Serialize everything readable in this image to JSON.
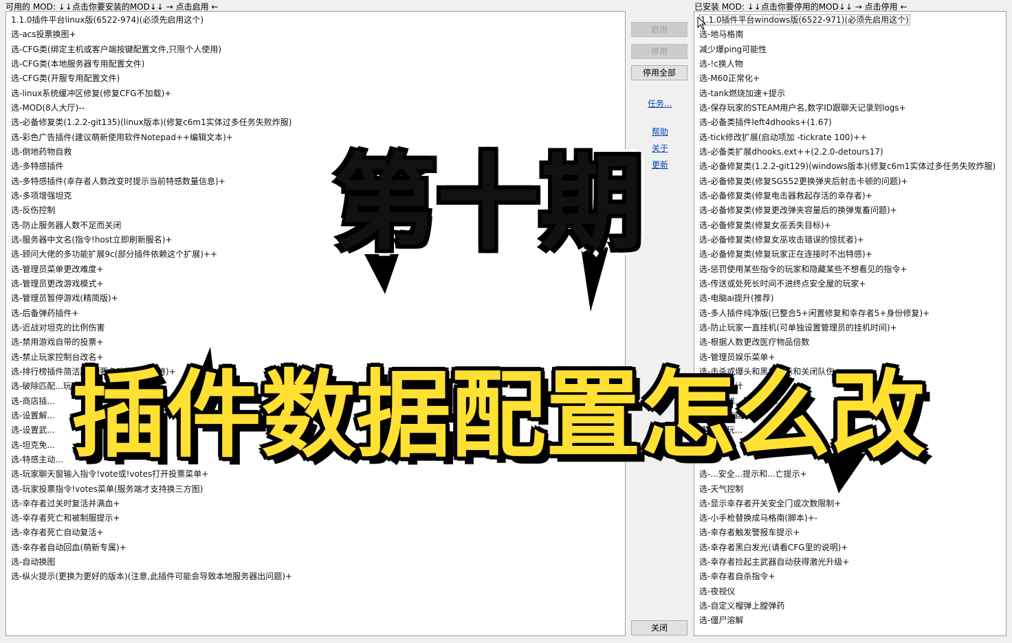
{
  "headers": {
    "available": "可用的 MOD: ↓↓点击你要安装的MOD↓↓ → 点击启用 ←",
    "installed": "已安装 MOD: ↓↓点击你要停用的MOD↓↓ → 点击停用 ←"
  },
  "available_mods": [
    "1.1.0插件平台linux版(6522-974)(必须先启用这个)",
    "选-acs投票换图+",
    "选-CFG类(绑定主机或客户端按键配置文件,只限个人使用)",
    "选-CFG类(本地服务器专用配置文件)",
    "选-CFG类(开服专用配置文件)",
    "选-linux系统缓冲区修复(修复CFG不加载)+",
    "选-MOD(8人大厅)--",
    "选-必备修复类(1.2.2-git135)(linux版本)(修复c6m1实体过多任务失败炸服)",
    "选-彩色广告插件(建议萌新使用软件Notepad++编辑文本)+",
    "选-倒地药物自救",
    "选-多特感插件",
    "选-多特感插件(幸存者人数改变时提示当前特感数量信息)+",
    "选-多项增强坦克",
    "选-反伤控制",
    "选-防止服务器人数不足而关闭",
    "选-服务器中文名(指令!host立即刷新服名)+",
    "选-顾问大佬的多功能扩展9c(部分插件依赖这个扩展)++",
    "选-管理员菜单更改难度+",
    "选-管理员更改游戏模式+",
    "选-管理员暂停游戏(精简版)+",
    "选-后备弹药插件+",
    "选-近战对坦克的比例伤害",
    "选-禁用游戏自带的投票+",
    "选-禁止玩家控制台改名+",
    "选-排行榜插件简洁版(需要多功能扩展支持)+",
    "选-破除匹配...玩家",
    "选-商店插...",
    "选-设置解...",
    "选-设置武...",
    "选-坦克免...",
    "选-特感主动...",
    "选-玩家聊天窗输入指令!vote或!votes打开投票菜单+",
    "选-玩家投票指令!votes菜单(服务端才支持换三方图)",
    "选-幸存者过关时复活并满血+",
    "选-幸存者死亡和被制服提示+",
    "选-幸存者死亡自动复活+",
    "选-幸存者自动回血(萌新专属)+",
    "选-自动换图",
    "选-纵火提示(更换为更好的版本)(注意,此插件可能会导致本地服务器出问题)+"
  ],
  "installed_mods": [
    "1.1.0插件平台windows版(6522-971)(必须先启用这个)",
    "选-地马格南",
    "减少爆ping可能性",
    "选-!c换人物",
    "选-M60正常化+",
    "选-tank燃烧加速+提示",
    "选-保存玩家的STEAM用户名,数字ID跟聊天记录到logs+",
    "选-必备类插件left4dhooks+(1.67)",
    "选-tick修改扩展(启动项加 -tickrate 100)++",
    "选-必备类扩展dhooks.ext++(2.2.0-detours17)",
    "选-必备修复类(1.2.2-git129)(windows版本)(修复c6m1实体过多任务失败炸服)",
    "选-必备修复类(修复SG552更换弹夹后射击卡顿的问题)+",
    "选-必备修复类(修复电击器救起存活的幸存者)+",
    "选-必备修复类(修复更改弹夹容量后的换弹鬼畜问题)+",
    "选-必备修复类(修复女巫丢失目标)+",
    "选-必备修复类(修复女巫攻击错误的惊扰者)+",
    "选-必备修复类(修复玩家正在连接时不出特感)+",
    "选-惩罚使用某些指令的玩家和隐藏某些不想看见的指令+",
    "选-传送或处死长时间不进终点安全屋的玩家+",
    "选-电脑ai提升(推荐)",
    "选-多人插件纯净版(已整合5+闲置修复和幸存者5+身份修复)+",
    "选-防止玩家一直挂机(可单独设置管理员的挂机时间)+",
    "选-根据人数更改医疗物品倍数",
    "选-管理员娱乐菜单+",
    "选-击杀或爆头和黑枪提示和关闭队伤+",
    "选-...名统计",
    "选-...感知...量和前置...",
    "选-...动连跳",
    "选-...的玩...",
    "选-...上...",
    "选-...",
    "选-...安全...提示和...亡提示+",
    "选-天气控制",
    "选-显示幸存者开关安全门或次数限制+",
    "选-小手枪替换成马格南(脚本)+-",
    "选-幸存者触发警报车提示+",
    "选-幸存者黑白发光(请看CFG里的说明)+",
    "选-幸存者捡起主武器自动获得激光升级+",
    "选-幸存者自杀指令+",
    "选-夜视仪",
    "选-自定义榴弹上膛弹药",
    "选-僵尸溶解"
  ],
  "buttons": {
    "enable": "启用",
    "disable": "停用",
    "disable_all": "停用全部",
    "close": "关闭"
  },
  "links": {
    "tasks": "任务...",
    "help": "帮助",
    "about": "关于",
    "update": "更新"
  },
  "overlay": {
    "line1": "第十期",
    "line2": "插件数据配置怎么改"
  },
  "colors": {
    "overlay_yellow": "#ffe033",
    "link_blue": "#0645ad"
  }
}
